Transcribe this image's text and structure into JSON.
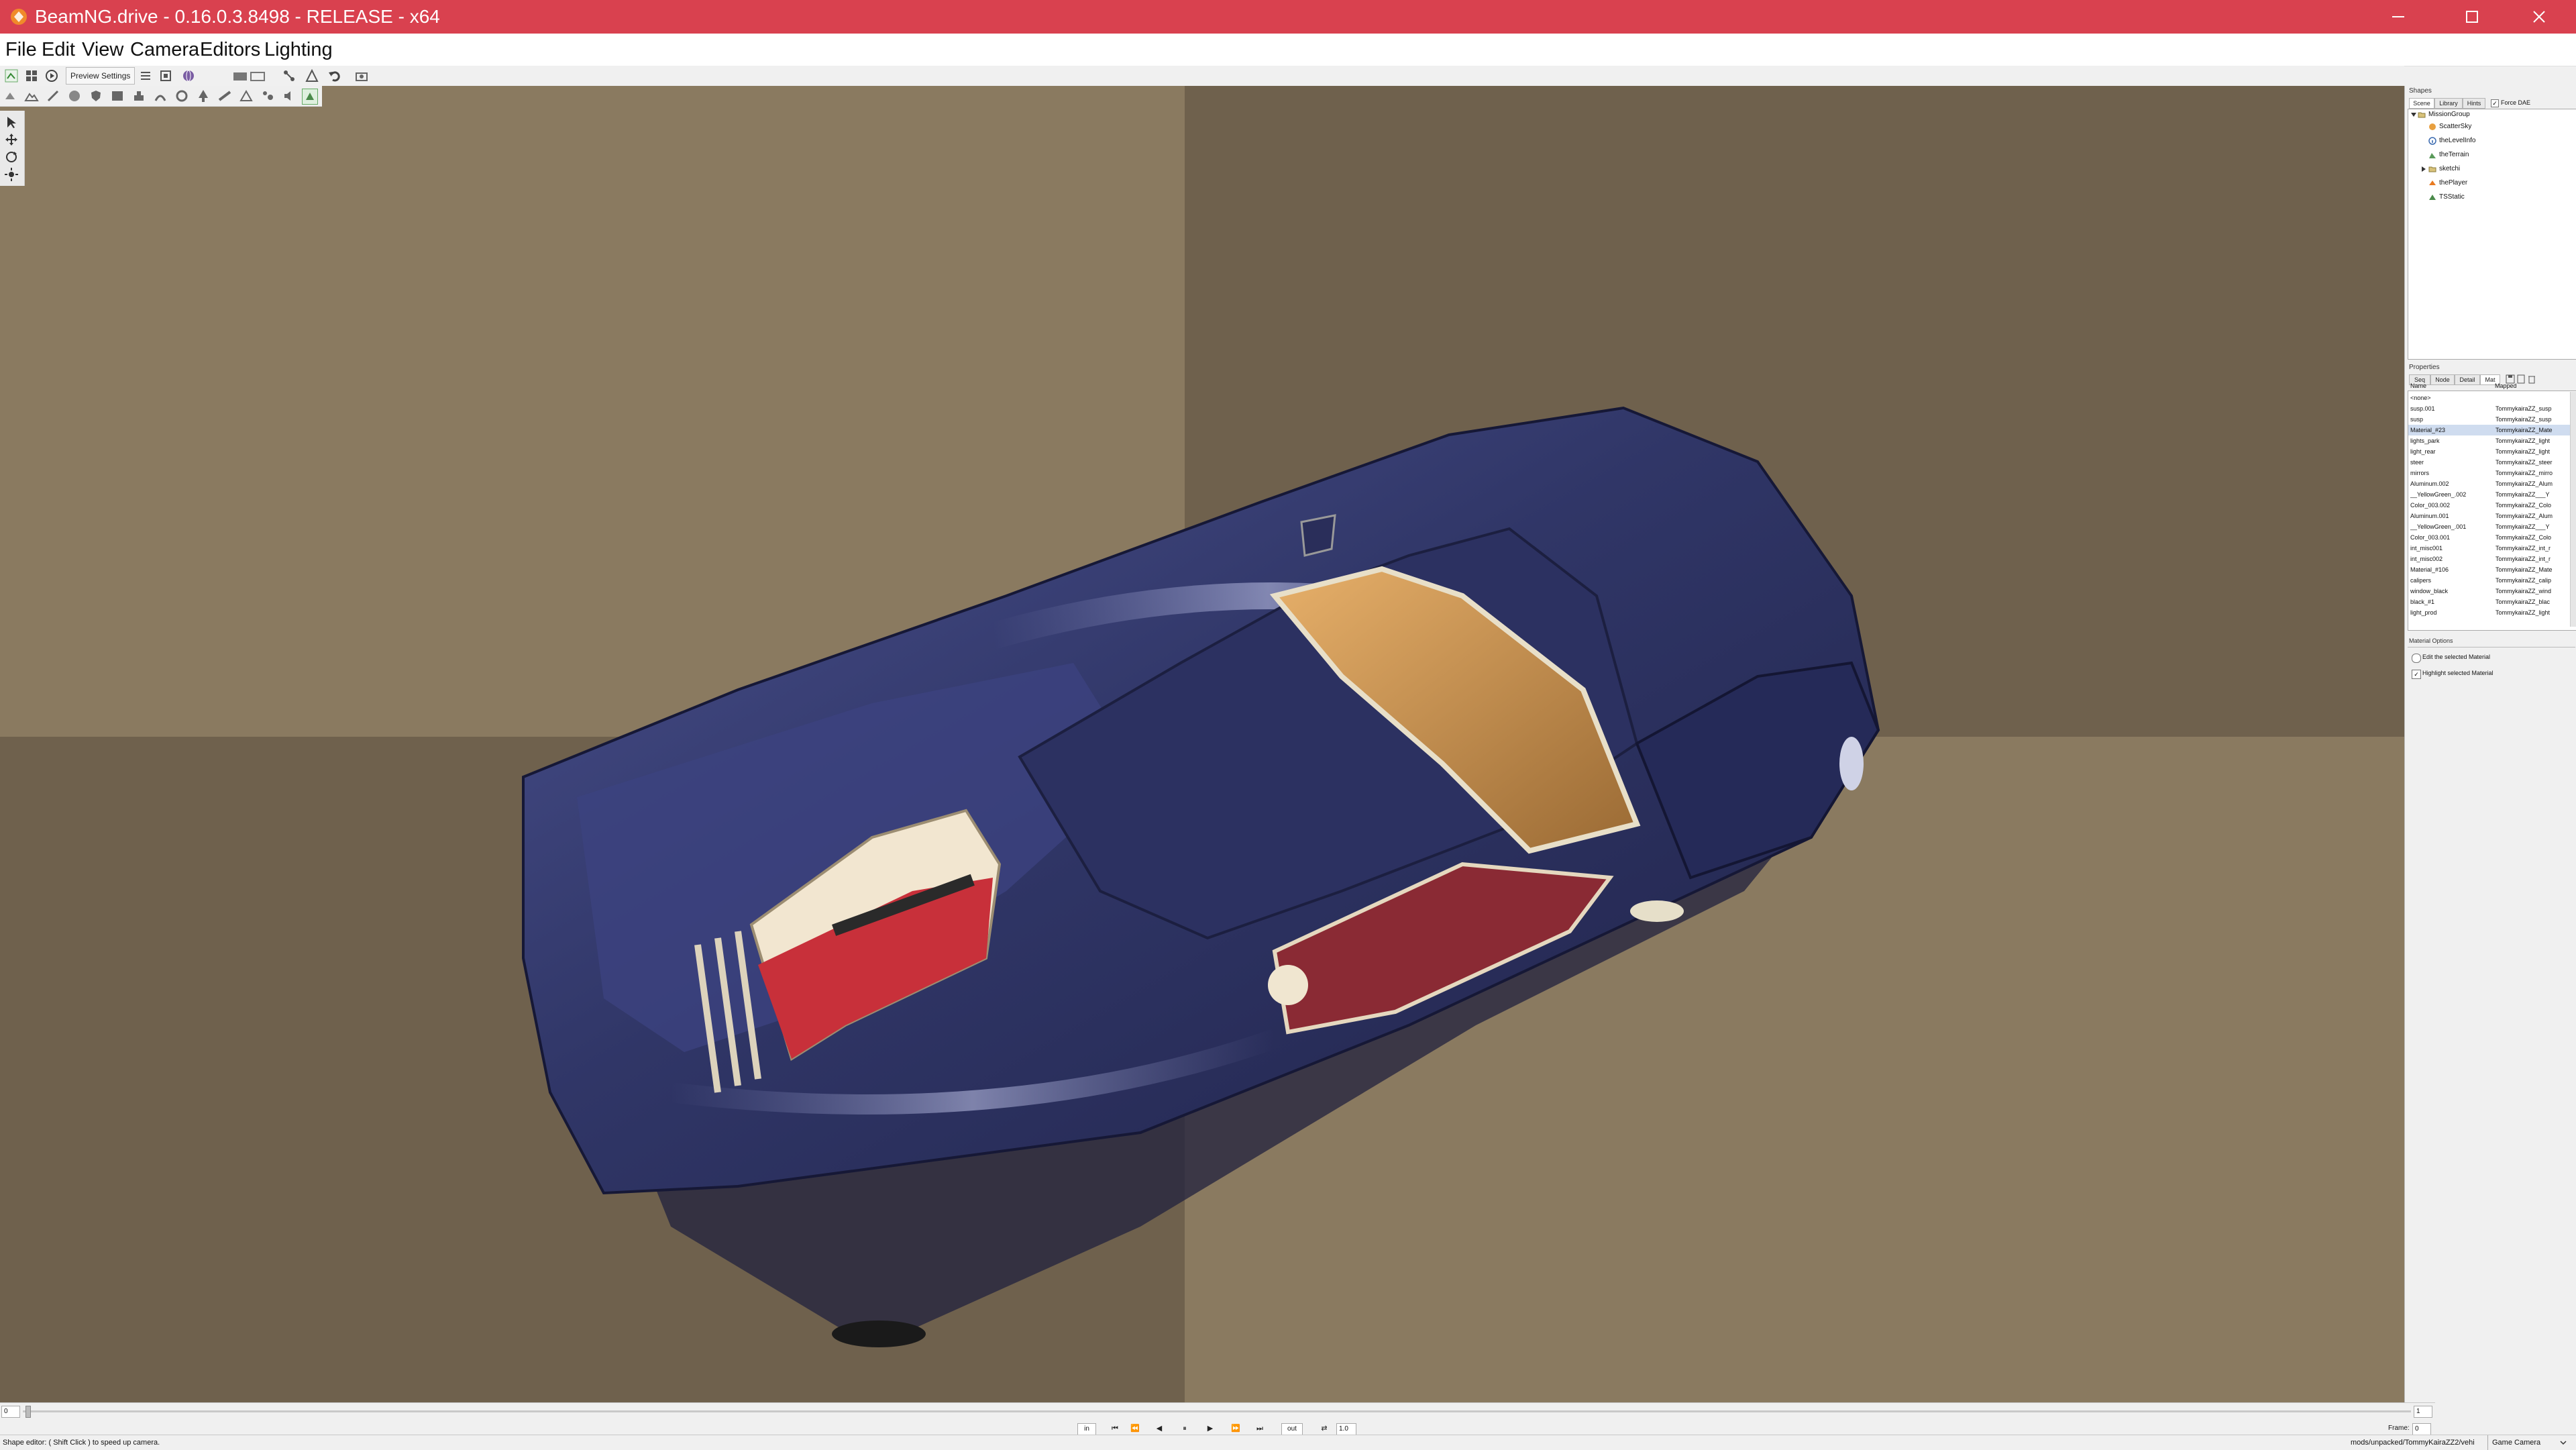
{
  "window": {
    "title": "BeamNG.drive - 0.16.0.3.8498 - RELEASE - x64",
    "minimize_icon": "minimize-icon",
    "maximize_icon": "maximize-icon",
    "close_icon": "close-icon"
  },
  "menu": [
    "File",
    "Edit",
    "View",
    "Camera",
    "Editors",
    "Lighting"
  ],
  "toolbar": {
    "preview_settings": "Preview Settings"
  },
  "shapes_panel": {
    "title": "Shapes",
    "tabs": [
      "Scene",
      "Library",
      "Hints"
    ],
    "force_dae_label": "Force DAE",
    "tree": [
      {
        "label": "MissionGroup",
        "icon": "folder-icon"
      },
      {
        "label": "ScatterSky",
        "icon": "sky-icon"
      },
      {
        "label": "theLevelInfo",
        "icon": "info-icon"
      },
      {
        "label": "theTerrain",
        "icon": "terrain-icon"
      },
      {
        "label": "sketchi",
        "icon": "folder-icon"
      },
      {
        "label": "thePlayer",
        "icon": "player-icon"
      },
      {
        "label": "TSStatic",
        "icon": "static-shape-icon"
      }
    ]
  },
  "properties_panel": {
    "title": "Properties",
    "tabs": [
      "Seq",
      "Node",
      "Detail",
      "Mat"
    ],
    "columns": [
      "Name",
      "Mapped"
    ],
    "materials": [
      {
        "name": "<none>",
        "mapped": ""
      },
      {
        "name": "susp.001",
        "mapped": "TommykairaZZ_susp"
      },
      {
        "name": "susp",
        "mapped": "TommykairaZZ_susp"
      },
      {
        "name": "Material_#23",
        "mapped": "TommykairaZZ_Mate"
      },
      {
        "name": "lights_park",
        "mapped": "TommykairaZZ_light"
      },
      {
        "name": "light_rear",
        "mapped": "TommykairaZZ_light"
      },
      {
        "name": "steer",
        "mapped": "TommykairaZZ_steer"
      },
      {
        "name": "mirrors",
        "mapped": "TommykairaZZ_mirro"
      },
      {
        "name": "Aluminum.002",
        "mapped": "TommykairaZZ_Alum"
      },
      {
        "name": "__YellowGreen_.002",
        "mapped": "TommykairaZZ___Y"
      },
      {
        "name": "Color_003.002",
        "mapped": "TommykairaZZ_Colo"
      },
      {
        "name": "Aluminum.001",
        "mapped": "TommykairaZZ_Alum"
      },
      {
        "name": "__YellowGreen_.001",
        "mapped": "TommykairaZZ___Y"
      },
      {
        "name": "Color_003.001",
        "mapped": "TommykairaZZ_Colo"
      },
      {
        "name": "int_misc001",
        "mapped": "TommykairaZZ_int_r"
      },
      {
        "name": "int_misc002",
        "mapped": "TommykairaZZ_int_r"
      },
      {
        "name": "Material_#106",
        "mapped": "TommykairaZZ_Mate"
      },
      {
        "name": "calipers",
        "mapped": "TommykairaZZ_calip"
      },
      {
        "name": "window_black",
        "mapped": "TommykairaZZ_wind"
      },
      {
        "name": "black_#1",
        "mapped": "TommykairaZZ_blac"
      },
      {
        "name": "light_prod",
        "mapped": "TommykairaZZ_light"
      }
    ],
    "selected_index": 3,
    "material_options_title": "Material Options",
    "edit_material_label": "Edit the selected Material",
    "highlight_material_label": "Highlight selected Material"
  },
  "timeline": {
    "start_value": "0",
    "end_value": "1",
    "in_label": "in",
    "out_label": "out",
    "speed_value": "1.0",
    "frame_label": "Frame:",
    "frame_value": "0"
  },
  "status": {
    "hint": "Shape editor: ( Shift Click ) to speed up camera.",
    "path": "mods/unpacked/TommyKairaZZ2/vehi",
    "camera": "Game Camera"
  },
  "colors": {
    "titlebar": "#d9414f",
    "floor_light": "#8a7a60",
    "floor_dark": "#6f614d",
    "car_body": "#3a3f72"
  }
}
